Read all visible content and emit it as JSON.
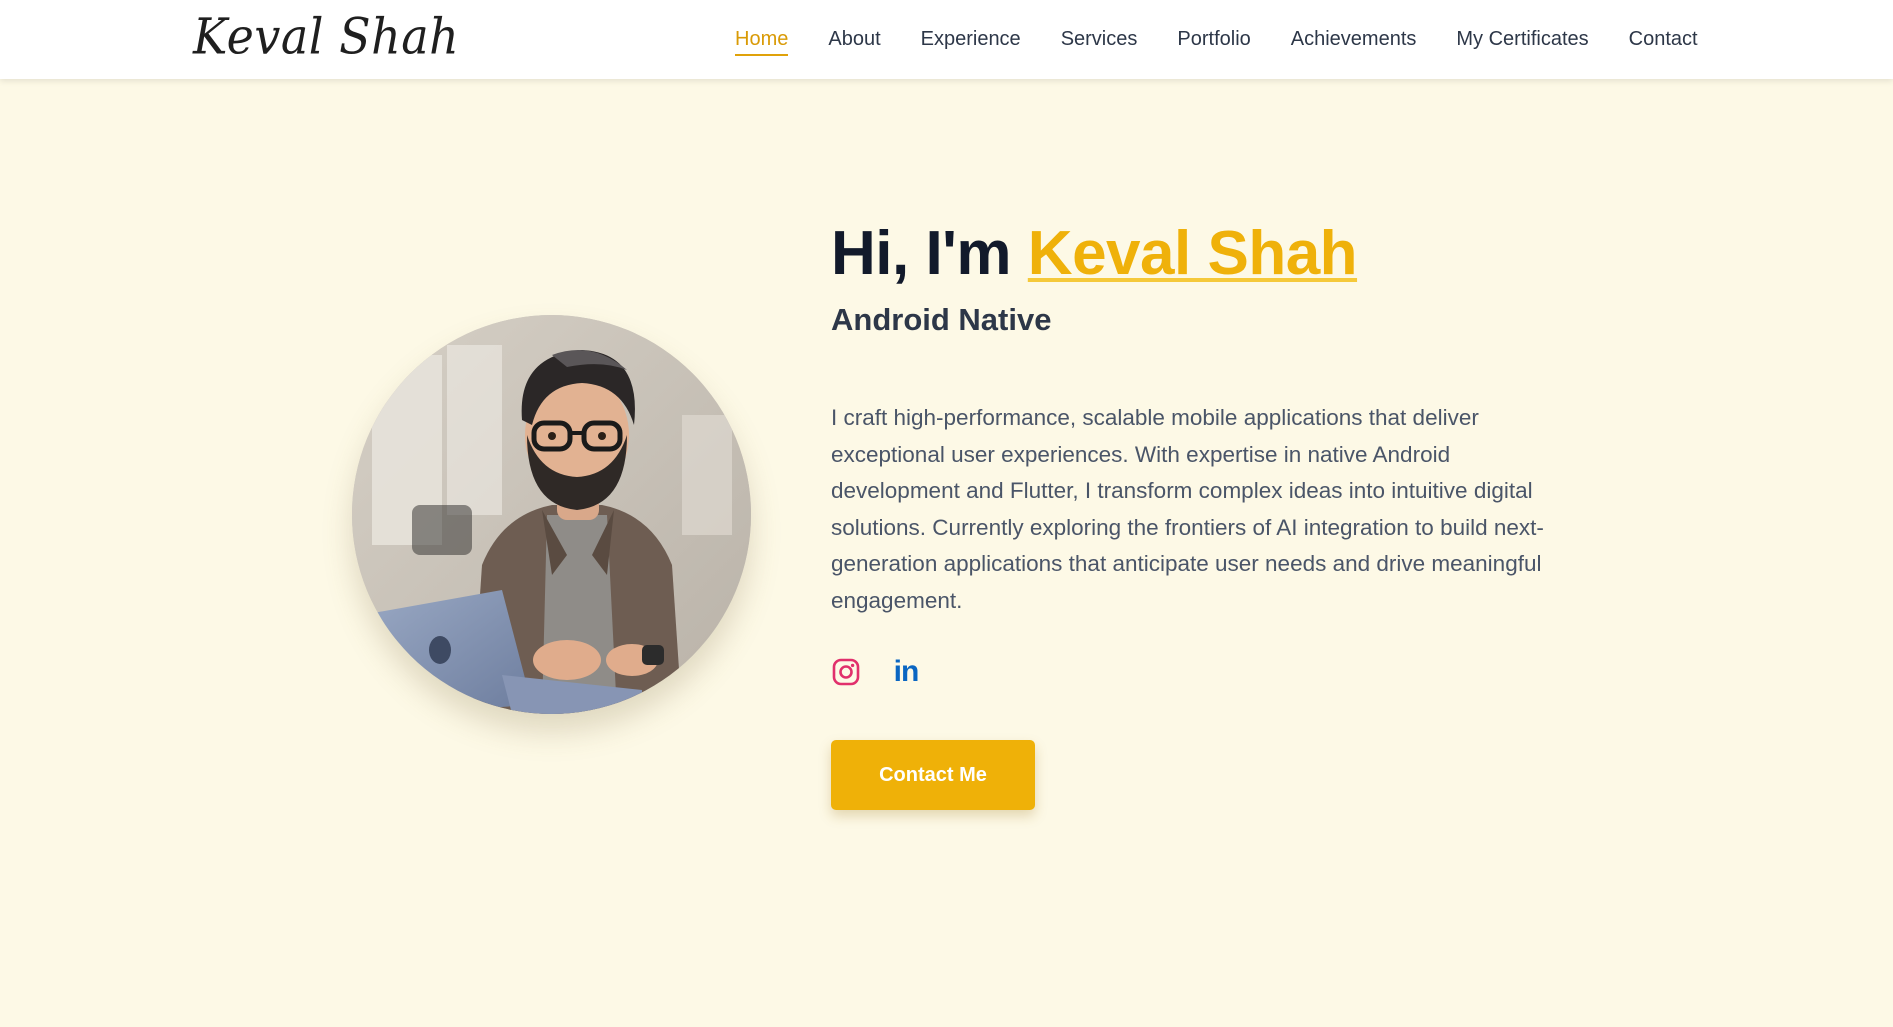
{
  "brand": {
    "name": "Keval Shah"
  },
  "nav": {
    "items": [
      {
        "label": "Home",
        "active": true
      },
      {
        "label": "About"
      },
      {
        "label": "Experience"
      },
      {
        "label": "Services"
      },
      {
        "label": "Portfolio"
      },
      {
        "label": "Achievements"
      },
      {
        "label": "My Certificates"
      },
      {
        "label": "Contact"
      }
    ]
  },
  "hero": {
    "greeting": "Hi, I'm",
    "name": "Keval Shah",
    "role": "Android Native",
    "description": "I craft high-performance, scalable mobile applications that deliver exceptional user experiences. With expertise in native Android development and Flutter, I transform complex ideas into intuitive digital solutions. Currently exploring the frontiers of AI integration to build next-generation applications that anticipate user needs and drive meaningful engagement.",
    "cta_label": "Contact Me",
    "social": [
      {
        "icon": "instagram-icon",
        "color": "#e1306c"
      },
      {
        "icon": "linkedin-icon",
        "glyph": "in",
        "color": "#0a66c2"
      }
    ]
  },
  "colors": {
    "accent": "#efb108",
    "background": "#fdf9e6",
    "heading": "#121a2b",
    "body_text": "#4a5568"
  }
}
